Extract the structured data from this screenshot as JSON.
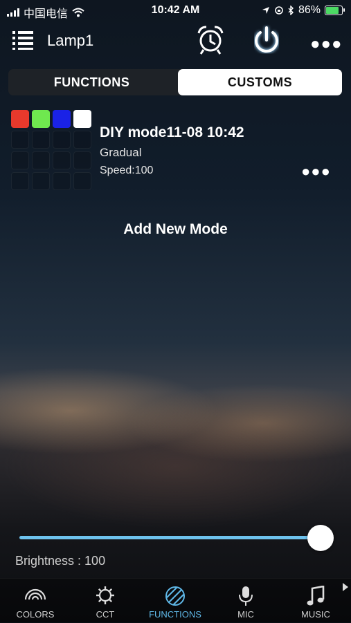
{
  "status_bar": {
    "carrier": "中国电信",
    "time": "10:42 AM",
    "battery": "86%"
  },
  "header": {
    "device_name": "Lamp1"
  },
  "segment": {
    "functions_label": "FUNCTIONS",
    "customs_label": "CUSTOMS",
    "selected": "CUSTOMS"
  },
  "mode": {
    "title": "DIY mode11-08 10:42",
    "type": "Gradual",
    "speed": "Speed:100",
    "colors": [
      "#e8392c",
      "#6fe84f",
      "#1a22e6",
      "#ffffff"
    ]
  },
  "add_mode_label": "Add New Mode",
  "brightness": {
    "label": "Brightness : 100",
    "value": 100
  },
  "tabs": [
    {
      "label": "COLORS",
      "icon": "rainbow-icon"
    },
    {
      "label": "CCT",
      "icon": "sun-gear-icon"
    },
    {
      "label": "FUNCTIONS",
      "icon": "striped-circle-icon",
      "active": true
    },
    {
      "label": "MIC",
      "icon": "microphone-icon"
    },
    {
      "label": "MUSIC",
      "icon": "music-note-icon"
    }
  ],
  "colors": {
    "accent": "#5fb7e6",
    "slider": "#6ec3ee"
  }
}
